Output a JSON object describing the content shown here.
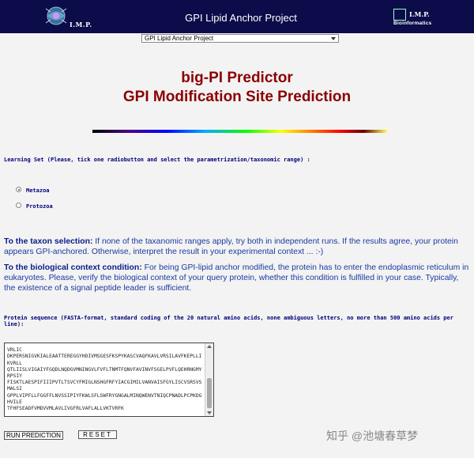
{
  "header": {
    "left_logo_text": "I.M.P.",
    "title": "GPI Lipid Anchor Project",
    "right_logo_text": "I.M.P.",
    "right_logo_subtext": "Bioinformatics"
  },
  "nav": {
    "selected": "GPI Lipid Anchor Project"
  },
  "headings": {
    "line1": "big-PI Predictor",
    "line2": "GPI Modification Site Prediction"
  },
  "learning_set": {
    "label": "Learning Set (Please, tick one radiobutton and select the parametrization/taxonomic range) :",
    "options": [
      {
        "label": "Metazoa",
        "checked": true
      },
      {
        "label": "Protozoa",
        "checked": false
      }
    ]
  },
  "notes": {
    "taxon_title": "To the taxon selection:",
    "taxon_text": " If none of the taxanomic ranges apply, try both in independent runs. If the results agree, your protein appears GPI-anchored. Otherwise, interpret the result in your experimental context ... :-)",
    "bio_title": "To the biological context condition:",
    "bio_text": " For being GPI-lipid anchor modified, the protein has to enter the endoplasmic reticulum in eukaryotes. Please, verify the biological context of your query protein, whether this condition is fulfilled in your case. Typically, the existence of a signal peptide leader is sufficient."
  },
  "sequence": {
    "label": "Protein sequence (FASTA-format, standard coding of the 20 natural amino acids, none ambiguous letters, no more than 500 amino acids per line):",
    "lines": [
      "VRLIC",
      "DKPERSNIGVKIALEAATTEREGGYHDIVMSGESFKSPYKASCVAQFKAVLVRSILAVFKEPLLI",
      "KVRLL",
      "QTLIISLVIGAIYFGQDLNQDGVMNINGVLFVFLTNMTFQNVFAVINVFSGELPVFLQEHRNGMY",
      "RPSIY",
      "FISKTLAESPIFIIIPVTLTSVCYFMIGLNSHGFRFYIACGIMILVANVAISFGYLISCVSRSVS",
      "MALSI",
      "GPPLVIPFLLFGGFFLNVSSIPIYFKWLSFLSWFRYGNGALMINQWENVTNIQCPNADLPCPKDG",
      "HVILE",
      "TFHFSEADFVMDVVMLAVLIVGFRLVAFLALLVKTVRFK"
    ]
  },
  "buttons": {
    "run": "RUN PREDICTION",
    "reset": "RESET"
  },
  "watermark": "知乎 @池塘春草梦"
}
